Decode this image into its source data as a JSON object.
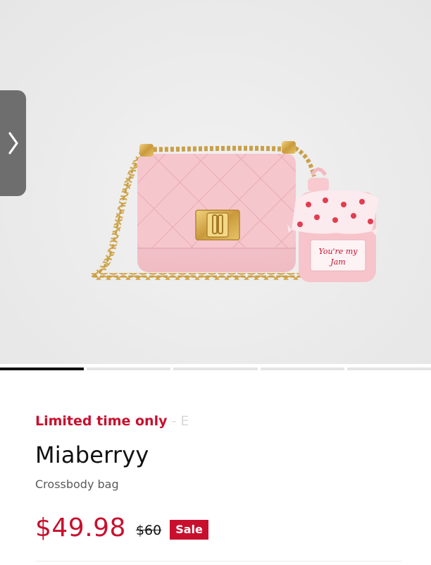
{
  "gallery": {
    "image_alt": "Pink quilted crossbody bag with gold chain and strawberry jam jar charm",
    "charm_text_line1": "You're my",
    "charm_text_line2": "Jam",
    "slide_count": 5,
    "active_slide": 1
  },
  "navigation": {
    "prev_icon": "chevron-icon",
    "prev_icon_color": "#ffffff",
    "prev_bg_color": "#6e6e6e"
  },
  "product": {
    "promo_text": "Limited time only",
    "promo_suffix": "- E",
    "name": "Miaberryy",
    "category": "Crossbody bag",
    "price_current": "$49.98",
    "price_original": "$60",
    "badge": "Sale"
  },
  "colors": {
    "accent": "#c8102e",
    "text": "#111111",
    "muted": "#5a5a5a",
    "indicator_active": "#111111",
    "indicator_inactive": "#e4e4e4"
  }
}
